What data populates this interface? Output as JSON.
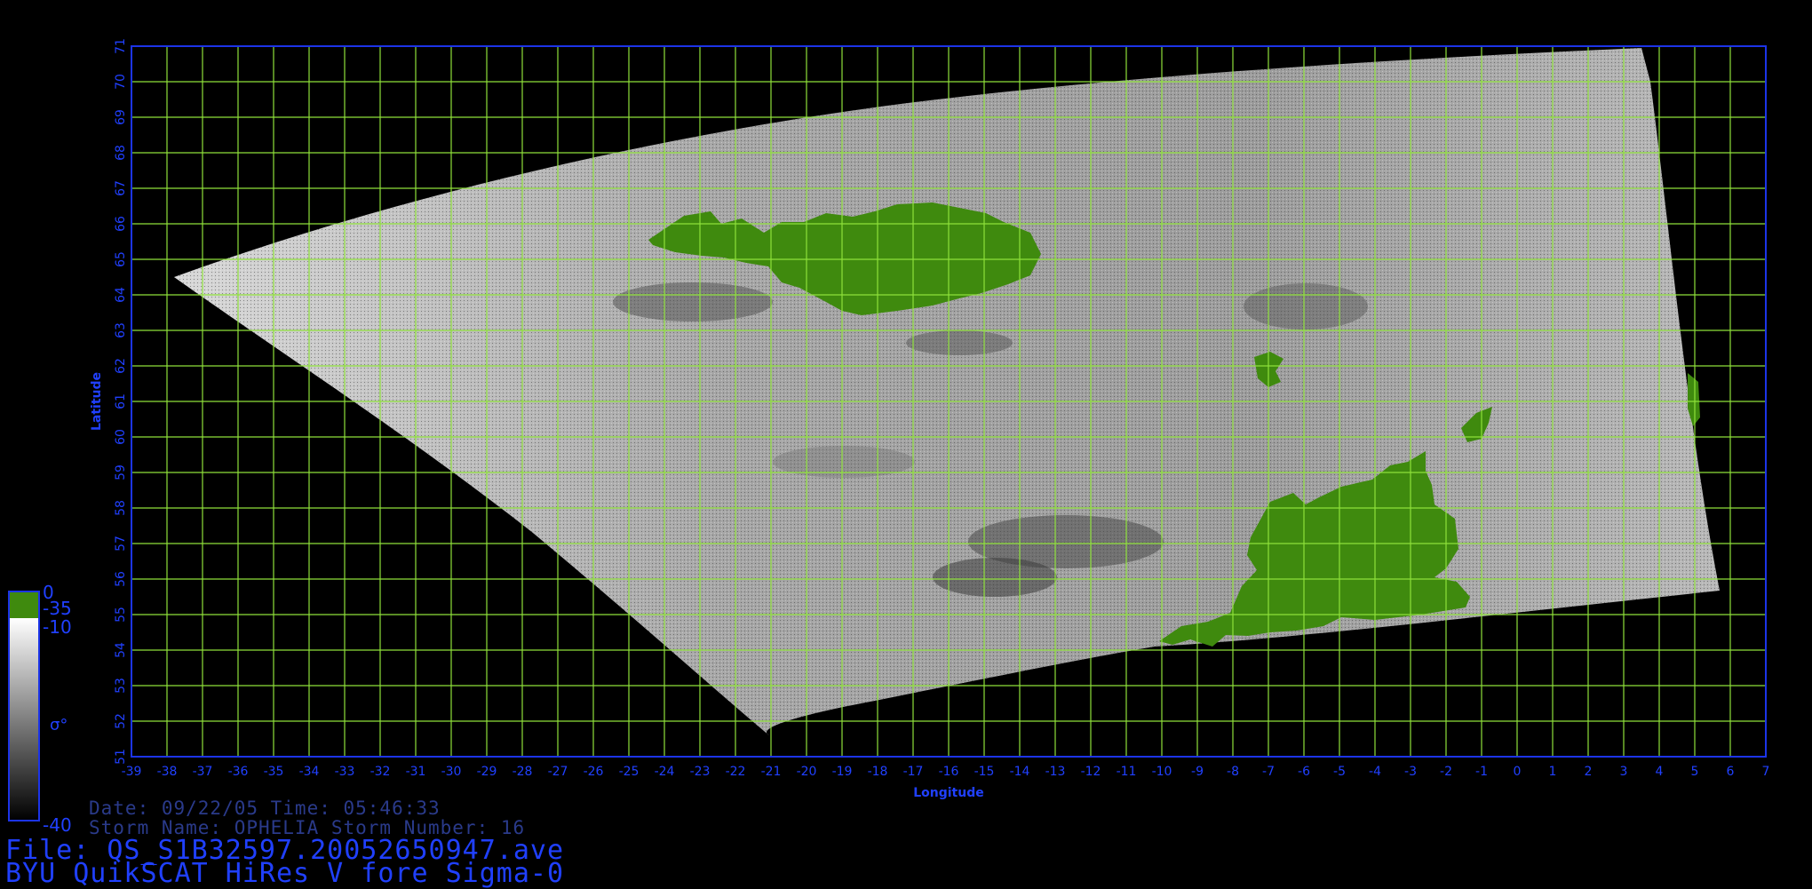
{
  "plot": {
    "x_label": "Longitude",
    "y_label": "Latitude",
    "x_ticks": [
      "-39",
      "-38",
      "-37",
      "-36",
      "-35",
      "-34",
      "-33",
      "-32",
      "-31",
      "-30",
      "-29",
      "-28",
      "-27",
      "-26",
      "-25",
      "-24",
      "-23",
      "-22",
      "-21",
      "-20",
      "-19",
      "-18",
      "-17",
      "-16",
      "-15",
      "-14",
      "-13",
      "-12",
      "-11",
      "-10",
      "-9",
      "-8",
      "-7",
      "-6",
      "-5",
      "-4",
      "-3",
      "-2",
      "-1",
      "0",
      "1",
      "2",
      "3",
      "4",
      "5",
      "6",
      "7"
    ],
    "y_ticks": [
      "51",
      "52",
      "53",
      "54",
      "55",
      "56",
      "57",
      "58",
      "59",
      "60",
      "61",
      "62",
      "63",
      "64",
      "65",
      "66",
      "67",
      "68",
      "69",
      "70",
      "71"
    ],
    "x_range": [
      -39,
      7
    ],
    "y_range": [
      51,
      71
    ],
    "grid": true,
    "colors": {
      "frame": "#1c34e8",
      "grid": "#8ee03a",
      "land": "#3f8a0e",
      "text": "#2040ff",
      "background": "#000000"
    }
  },
  "colorbar": {
    "label": "σ°",
    "tick_top": "0",
    "tick_land": "-35",
    "tick_upper": "-10",
    "tick_bottom": "-40"
  },
  "caption": {
    "date_line": "Date: 09/22/05  Time: 05:46:33",
    "storm_line": "Storm Name: OPHELIA  Storm Number: 16",
    "file_line": "File: QS_S1B32597.20052650947.ave",
    "title_line": "BYU QuikSCAT HiRes V fore Sigma-0"
  }
}
